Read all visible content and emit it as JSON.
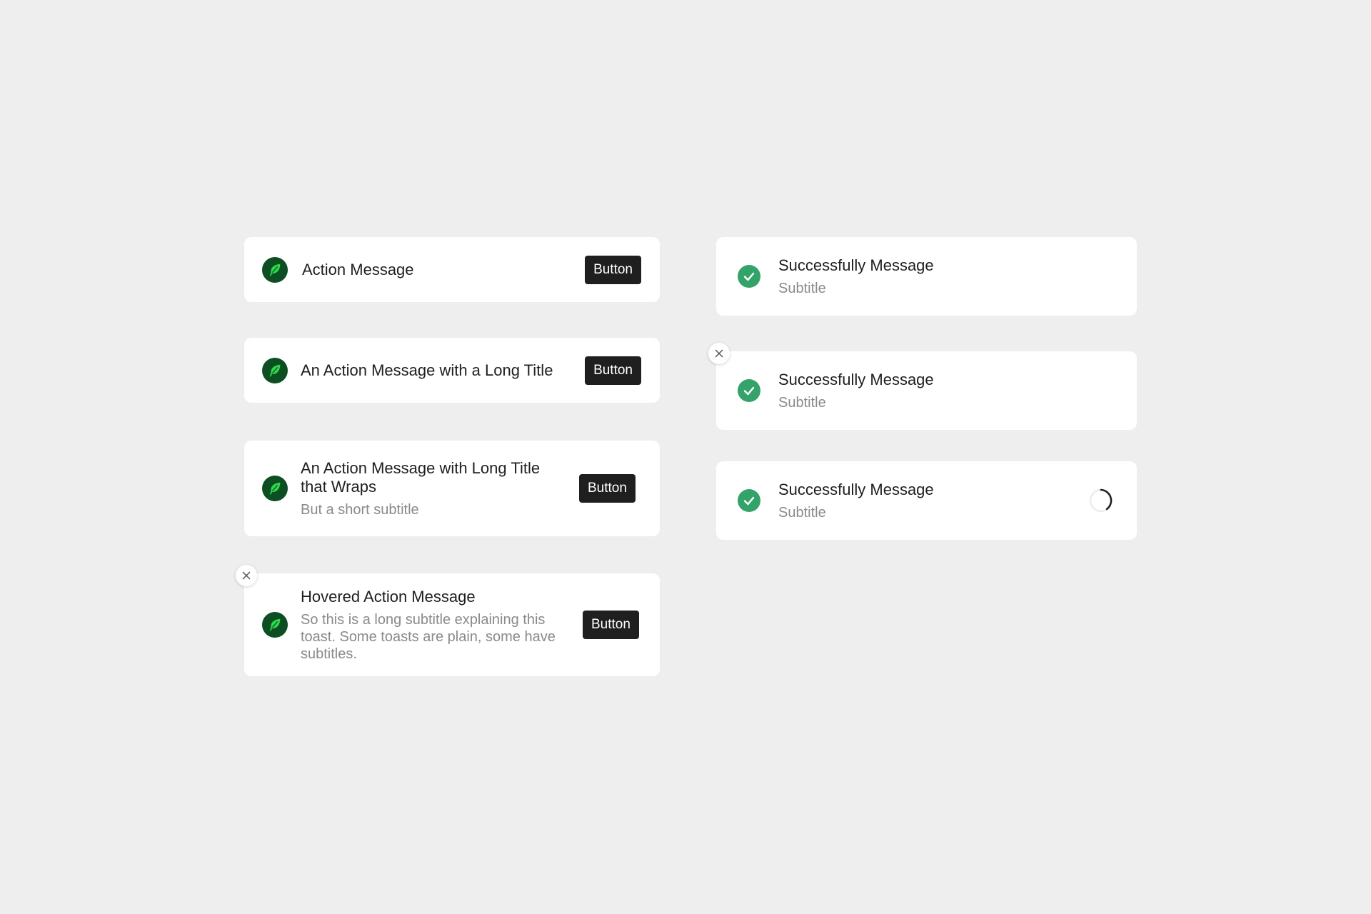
{
  "action_toasts": [
    {
      "title": "Action Message",
      "subtitle": "",
      "button_label": "Button",
      "icon": "leaf-icon"
    },
    {
      "title": "An Action Message with a Long Title",
      "subtitle": "",
      "button_label": "Button",
      "icon": "leaf-icon"
    },
    {
      "title": "An Action Message with Long Title that Wraps",
      "subtitle": "But a short subtitle",
      "button_label": "Button",
      "icon": "leaf-icon"
    },
    {
      "title": "Hovered Action Message",
      "subtitle": "So this is a long subtitle explaining this toast. Some toasts are plain, some have subtitles.",
      "button_label": "Button",
      "icon": "leaf-icon",
      "hovered": true
    }
  ],
  "success_toasts": [
    {
      "title": "Successfully Message",
      "subtitle": "Subtitle",
      "icon": "check-circle-icon"
    },
    {
      "title": "Successfully Message",
      "subtitle": "Subtitle",
      "icon": "check-circle-icon",
      "hovered": true
    },
    {
      "title": "Successfully Message",
      "subtitle": "Subtitle",
      "icon": "check-circle-icon",
      "loading": true
    }
  ],
  "colors": {
    "background": "#eeeeee",
    "card": "#ffffff",
    "button": "#1f1f1f",
    "leaf_badge": "#0d4f22",
    "leaf": "#2bd94a",
    "success": "#33a36a",
    "subtitle": "#8a8a8a"
  }
}
